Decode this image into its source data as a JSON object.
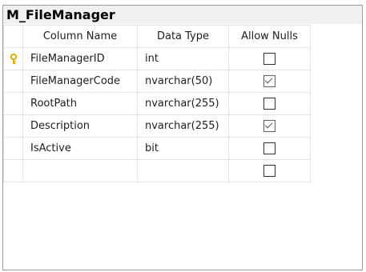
{
  "table_name": "M_FileManager",
  "headers": {
    "column_name": "Column Name",
    "data_type": "Data Type",
    "allow_nulls": "Allow Nulls"
  },
  "rows": [
    {
      "name": "FileManagerID",
      "type": "int",
      "allow_nulls": false,
      "primary_key": true,
      "indicator_icon": "primary-key-icon"
    },
    {
      "name": "FileManagerCode",
      "type": "nvarchar(50)",
      "allow_nulls": true
    },
    {
      "name": "RootPath",
      "type": "nvarchar(255)",
      "allow_nulls": false
    },
    {
      "name": "Description",
      "type": "nvarchar(255)",
      "allow_nulls": true
    },
    {
      "name": "IsActive",
      "type": "bit",
      "allow_nulls": false
    },
    {
      "name": "",
      "type": "",
      "allow_nulls": false
    }
  ],
  "colors": {
    "key_icon": "#d8b400",
    "grid_line": "#e3e3e3",
    "title_bar": "#f0f0f0"
  }
}
